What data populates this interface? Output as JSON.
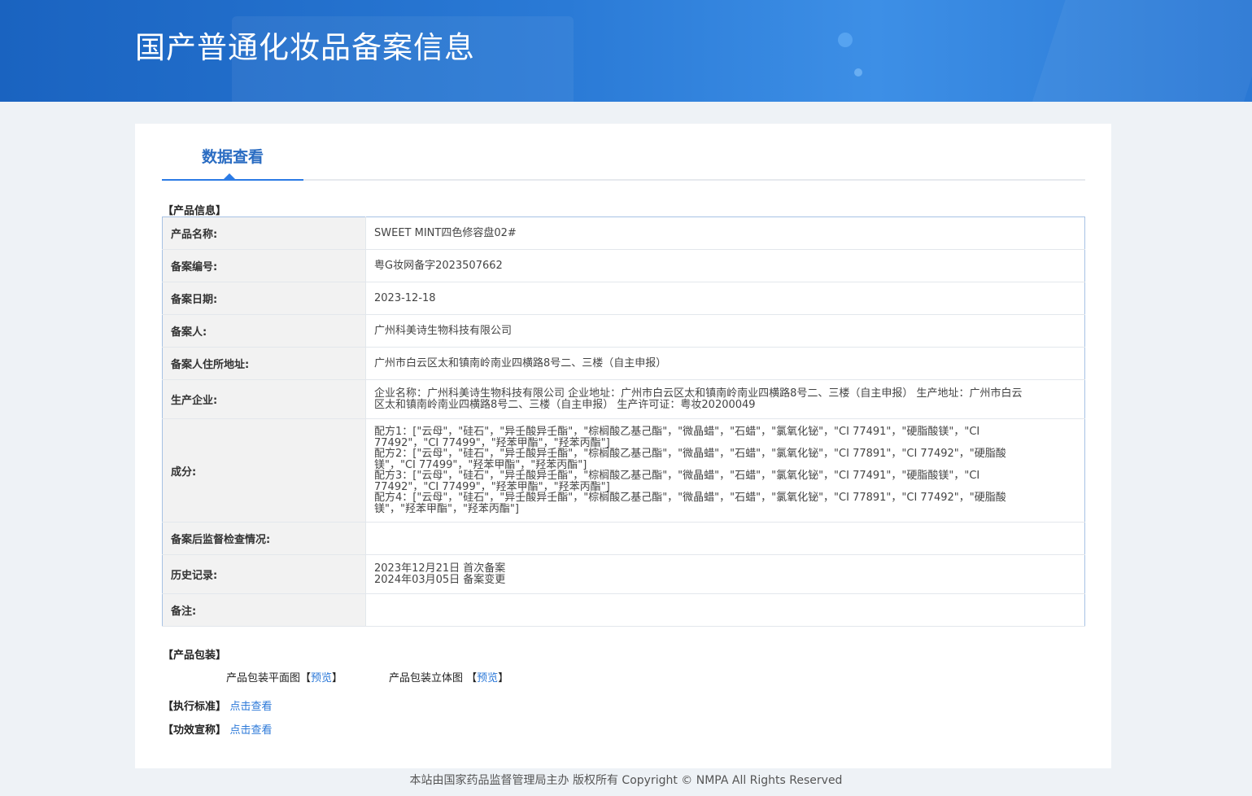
{
  "header": {
    "title": "国产普通化妆品备案信息"
  },
  "tabs": [
    {
      "label": "数据查看"
    }
  ],
  "product_info": {
    "section_title": "【产品信息】",
    "rows": [
      {
        "label": "产品名称:",
        "value": "SWEET MINT四色修容盘02#"
      },
      {
        "label": "备案编号:",
        "value": "粤G妆网备字2023507662"
      },
      {
        "label": "备案日期:",
        "value": "2023-12-18"
      },
      {
        "label": "备案人:",
        "value": "广州科美诗生物科技有限公司"
      },
      {
        "label": "备案人住所地址:",
        "value": "广州市白云区太和镇南岭南业四横路8号二、三楼（自主申报）"
      },
      {
        "label": "生产企业:",
        "lines": [
          "企业名称：广州科美诗生物科技有限公司 企业地址：广州市白云区太和镇南岭南业四横路8号二、三楼（自主申报） 生产地址：广州市白云",
          "区太和镇南岭南业四横路8号二、三楼（自主申报） 生产许可证：粤妆20200049"
        ]
      },
      {
        "label": "成分:",
        "lines": [
          "配方1：[\"云母\"，\"硅石\"，\"异壬酸异壬酯\"，\"棕榈酸乙基己酯\"，\"微晶蜡\"，\"石蜡\"，\"氯氧化铋\"，\"CI 77491\"，\"硬脂酸镁\"，\"CI",
          "77492\"，\"CI 77499\"，\"羟苯甲酯\"，\"羟苯丙酯\"]",
          "配方2：[\"云母\"，\"硅石\"，\"异壬酸异壬酯\"，\"棕榈酸乙基己酯\"，\"微晶蜡\"，\"石蜡\"，\"氯氧化铋\"，\"CI 77891\"，\"CI 77492\"，\"硬脂酸",
          "镁\"，\"CI 77499\"，\"羟苯甲酯\"，\"羟苯丙酯\"]",
          "配方3：[\"云母\"，\"硅石\"，\"异壬酸异壬酯\"，\"棕榈酸乙基己酯\"，\"微晶蜡\"，\"石蜡\"，\"氯氧化铋\"，\"CI 77491\"，\"硬脂酸镁\"，\"CI",
          "77492\"，\"CI 77499\"，\"羟苯甲酯\"，\"羟苯丙酯\"]",
          "配方4：[\"云母\"，\"硅石\"，\"异壬酸异壬酯\"，\"棕榈酸乙基己酯\"，\"微晶蜡\"，\"石蜡\"，\"氯氧化铋\"，\"CI 77891\"，\"CI 77492\"，\"硬脂酸",
          "镁\"，\"羟苯甲酯\"，\"羟苯丙酯\"]"
        ]
      },
      {
        "label": "备案后监督检查情况:",
        "value": ""
      },
      {
        "label": "历史记录:",
        "lines": [
          "2023年12月21日 首次备案",
          "2024年03月05日 备案变更"
        ]
      },
      {
        "label": "备注:",
        "value": ""
      }
    ]
  },
  "packaging": {
    "section_title": "【产品包装】",
    "flat_label": "产品包装平面图",
    "solid_label": "产品包装立体图",
    "bracket_open": "【",
    "bracket_close": "】",
    "preview_link": "预览"
  },
  "standard": {
    "label": "【执行标准】",
    "link": "点击查看"
  },
  "efficacy": {
    "label": "【功效宣称】",
    "link": "点击查看"
  },
  "footer": {
    "text": "本站由国家药品监督管理局主办 版权所有 Copyright © NMPA All Rights Reserved"
  }
}
